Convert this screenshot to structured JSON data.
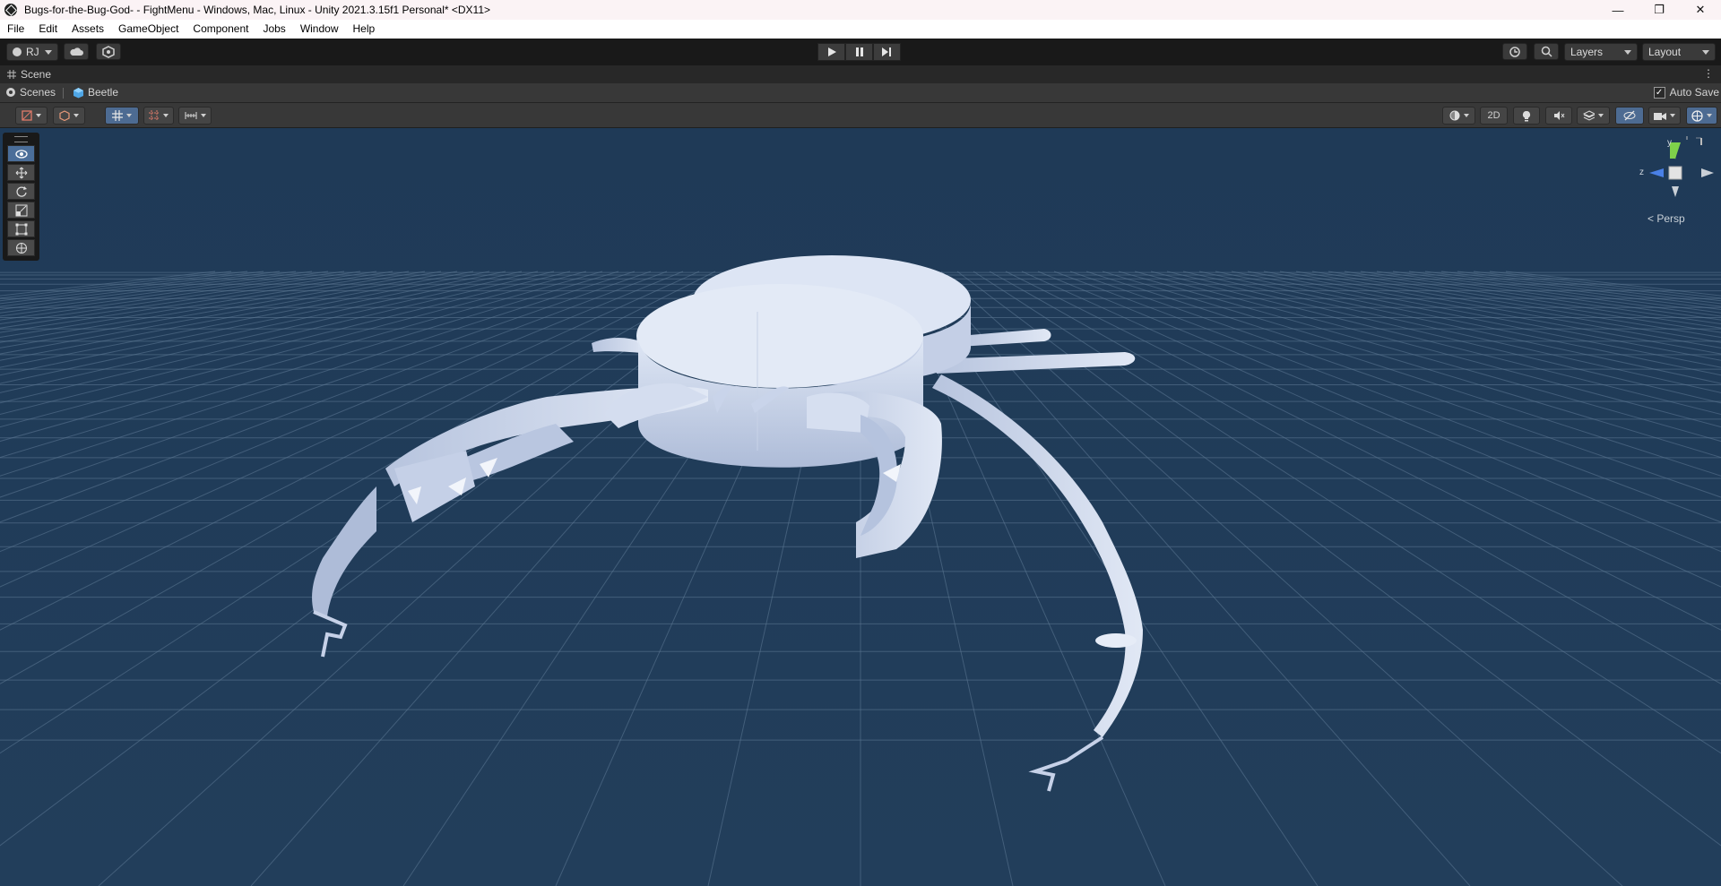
{
  "window": {
    "title": "Bugs-for-the-Bug-God- - FightMenu - Windows, Mac, Linux - Unity 2021.3.15f1 Personal* <DX11>",
    "controls": [
      "—",
      "❐",
      "✕"
    ]
  },
  "menu": [
    "File",
    "Edit",
    "Assets",
    "GameObject",
    "Component",
    "Jobs",
    "Window",
    "Help"
  ],
  "toolbar": {
    "account_label": "RJ",
    "layers_label": "Layers",
    "layout_label": "Layout"
  },
  "scene_tab": {
    "label": "Scene"
  },
  "breadcrumb": {
    "root": "Scenes",
    "current": "Beetle",
    "autosave_label": "Auto Save",
    "autosave_checked": true
  },
  "scene_toolbar": {
    "mode_2d_label": "2D"
  },
  "gizmo": {
    "projection_label": "Persp",
    "axis_y": "y",
    "axis_z": "z"
  },
  "colors": {
    "viewport_bg": "#1f3a57",
    "grid": "#5f7a96",
    "model": "#c8d4ea",
    "active_tool": "#4b6e99"
  }
}
